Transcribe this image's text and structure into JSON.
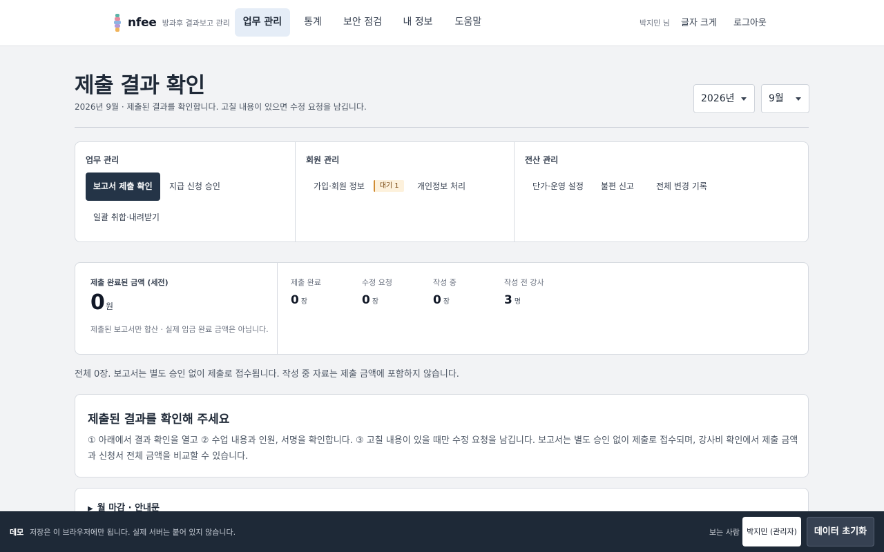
{
  "brand": {
    "name": "nfee",
    "subtitle": "방과후 결과보고 관리"
  },
  "nav": {
    "tabs": [
      "업무 관리",
      "통계",
      "보안 점검",
      "내 정보",
      "도움말"
    ],
    "active_index": 0,
    "user": "박지민 님",
    "font_size": "글자 크게",
    "logout": "로그아웃"
  },
  "header": {
    "title": "제출 결과 확인",
    "subtitle": "2026년 9월 · 제출된 결과를 확인합니다. 고칠 내용이 있으면 수정 요청을 남깁니다.",
    "year": "2026년",
    "month": "9월"
  },
  "menu": {
    "work": {
      "title": "업무 관리",
      "items": [
        "보고서 제출 확인",
        "지급 신청 승인",
        "일괄 취합·내려받기"
      ]
    },
    "members": {
      "title": "회원 관리",
      "items": [
        "가입·회원 정보",
        "개인정보 처리"
      ],
      "badge": "대기 1"
    },
    "system": {
      "title": "전산 관리",
      "items": [
        "단가·운영 설정",
        "불편 신고",
        "전체 변경 기록"
      ]
    }
  },
  "stats": {
    "amount_label": "제출 완료된 금액 (세전)",
    "amount_value": "0",
    "amount_unit": "원",
    "amount_note": "제출된 보고서만 합산 · 실제 입금 완료 금액은 아닙니다.",
    "items": [
      {
        "label": "제출 완료",
        "value": "0",
        "unit": "장"
      },
      {
        "label": "수정 요청",
        "value": "0",
        "unit": "장"
      },
      {
        "label": "작성 중",
        "value": "0",
        "unit": "장"
      },
      {
        "label": "작성 전 강사",
        "value": "3",
        "unit": "명"
      }
    ]
  },
  "summary": "전체 0장. 보고서는 별도 승인 없이 제출로 접수됩니다. 작성 중 자료는 제출 금액에 포함하지 않습니다.",
  "guide": {
    "title": "제출된 결과를 확인해 주세요",
    "body": "① 아래에서 결과 확인을 열고 ② 수업 내용과 인원, 서명을 확인합니다. ③ 고칠 내용이 있을 때만 수정 요청을 남깁니다. 보고서는 별도 승인 없이 제출로 접수되며, 강사비 확인에서 제출 금액과 신청서 전체 금액을 비교할 수 있습니다."
  },
  "details": {
    "summary": "월 마감 · 안내문"
  },
  "demo": {
    "tag": "데모",
    "text": "저장은 이 브라우저에만 됩니다. 실제 서버는 붙어 있지 않습니다.",
    "viewer_label": "보는 사람",
    "viewer_value": "박지민 (관리자)",
    "reset": "데이터 초기화"
  }
}
